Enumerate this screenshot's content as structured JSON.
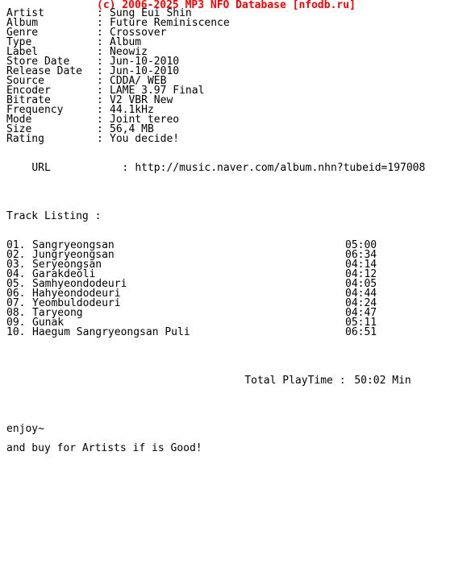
{
  "header": {
    "text": "(c) 2006-2025 MP3 NFO Database [nfodb.ru]",
    "color": "#ff0000"
  },
  "colors": {
    "background": "#ffffff",
    "text": "#000000",
    "accent": "#ff0000"
  },
  "info": {
    "separator": ":",
    "fields": [
      {
        "label": "Artist",
        "value": "Sung Eui Shin"
      },
      {
        "label": "Album",
        "value": "Future Reminiscence"
      },
      {
        "label": "Genre",
        "value": "Crossover"
      },
      {
        "label": "Type",
        "value": "Album"
      },
      {
        "label": "Label",
        "value": "Neowiz"
      },
      {
        "label": "Store Date",
        "value": "Jun-10-2010"
      },
      {
        "label": "Release Date",
        "value": "Jun-10-2010"
      },
      {
        "label": "Source",
        "value": "CDDA/ WEB"
      },
      {
        "label": "Encoder",
        "value": "LAME 3.97 Final"
      },
      {
        "label": "Bitrate",
        "value": "V2 VBR New"
      },
      {
        "label": "Frequency",
        "value": "44.1kHz"
      },
      {
        "label": "Mode",
        "value": "Joint tereo"
      },
      {
        "label": "Size",
        "value": "56,4 MB"
      },
      {
        "label": "Rating",
        "value": "You decide!"
      }
    ]
  },
  "url": {
    "label": "URL",
    "separator": ":",
    "value": "http://music.naver.com/album.nhn?tubeid=197008"
  },
  "tracklist": {
    "heading": "Track Listing :",
    "tracks": [
      {
        "num": "01.",
        "title": "Sangryeongsan",
        "time": "05:00"
      },
      {
        "num": "02.",
        "title": "Jungryeongsan",
        "time": "06:34"
      },
      {
        "num": "03.",
        "title": "Seryeongsan",
        "time": "04:14"
      },
      {
        "num": "04.",
        "title": "Garakdeoli",
        "time": "04:12"
      },
      {
        "num": "05.",
        "title": "Samhyeondodeuri",
        "time": "04:05"
      },
      {
        "num": "06.",
        "title": "Hahyeondodeuri",
        "time": "04:44"
      },
      {
        "num": "07.",
        "title": "Yeombuldodeuri",
        "time": "04:24"
      },
      {
        "num": "08.",
        "title": "Taryeong",
        "time": "04:47"
      },
      {
        "num": "09.",
        "title": "Gunak",
        "time": "05:11"
      },
      {
        "num": "10.",
        "title": "Haegum Sangryeongsan Puli",
        "time": "06:51"
      }
    ]
  },
  "total": {
    "label": "Total PlayTime :",
    "value": "50:02 Min"
  },
  "footer": {
    "line1": "enjoy~",
    "line2": "and buy for Artists if is Good!"
  }
}
